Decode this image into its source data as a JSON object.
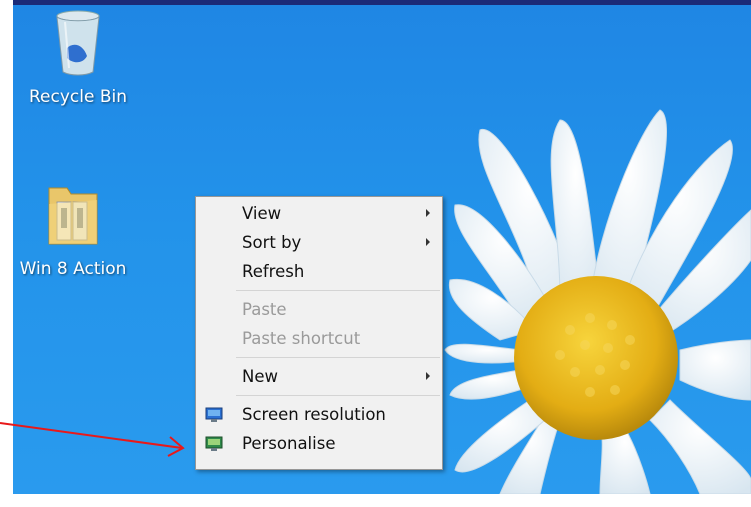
{
  "desktop": {
    "icons": [
      {
        "name": "Recycle Bin",
        "icon": "recycle-bin-icon"
      },
      {
        "name": "Win 8 Action",
        "icon": "folder-icon"
      }
    ]
  },
  "context_menu": {
    "items": [
      {
        "label": "View",
        "submenu": true,
        "enabled": true
      },
      {
        "label": "Sort by",
        "submenu": true,
        "enabled": true
      },
      {
        "label": "Refresh",
        "submenu": false,
        "enabled": true
      },
      {
        "label": "Paste",
        "submenu": false,
        "enabled": false
      },
      {
        "label": "Paste shortcut",
        "submenu": false,
        "enabled": false
      },
      {
        "label": "New",
        "submenu": true,
        "enabled": true
      },
      {
        "label": "Screen resolution",
        "icon": "display-icon",
        "submenu": false,
        "enabled": true
      },
      {
        "label": "Personalise",
        "icon": "personalise-icon",
        "submenu": false,
        "enabled": true,
        "highlighted_by_annotation": true
      }
    ]
  },
  "annotation": {
    "type": "arrow",
    "color": "#e8191a",
    "points_to": "Personalise"
  },
  "colors": {
    "desktop_blue": "#2393ea",
    "menu_background": "#f1f1f1",
    "disabled_text": "#9a9a9a",
    "flower_center": "#e8b818"
  }
}
